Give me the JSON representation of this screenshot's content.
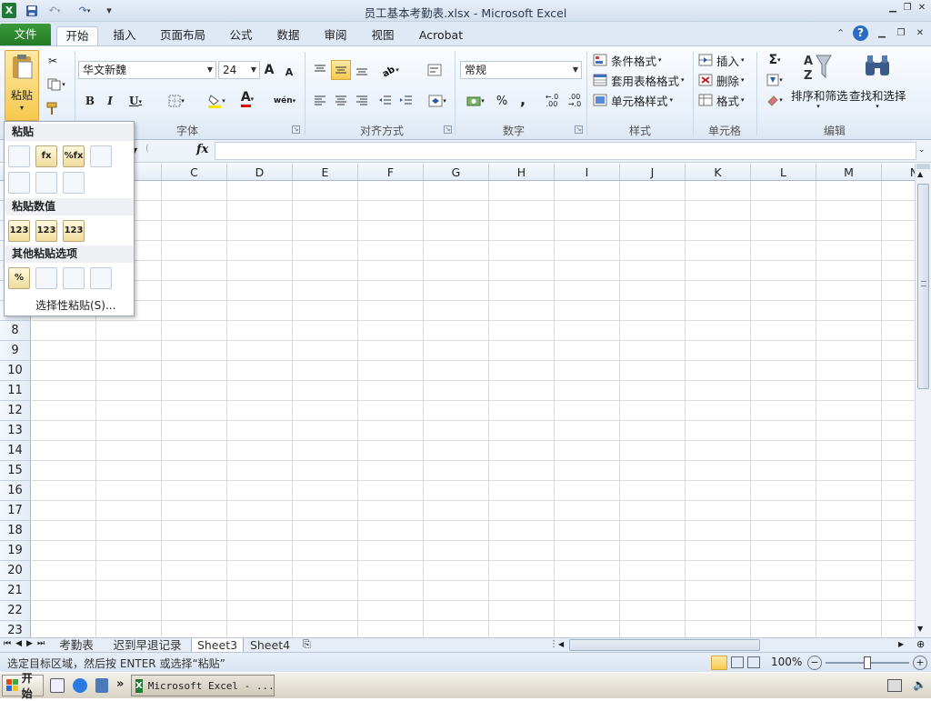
{
  "window": {
    "title": "员工基本考勤表.xlsx  -  Microsoft Excel"
  },
  "qat": {
    "app_icon": "excel-icon",
    "save_icon": "save-icon",
    "undo_icon": "undo-icon",
    "redo_icon": "redo-icon",
    "customize_icon": "customize-qat-icon"
  },
  "tabs": [
    {
      "label": "文件"
    },
    {
      "label": "开始"
    },
    {
      "label": "插入"
    },
    {
      "label": "页面布局"
    },
    {
      "label": "公式"
    },
    {
      "label": "数据"
    },
    {
      "label": "审阅"
    },
    {
      "label": "视图"
    },
    {
      "label": "Acrobat"
    }
  ],
  "ribbon": {
    "clipboard": {
      "paste_label": "粘贴",
      "cut_icon": "cut-icon",
      "copy_icon": "copy-icon",
      "format_painter_icon": "format-painter-icon"
    },
    "font": {
      "group_label": "字体",
      "font_name": "华文新魏",
      "font_size": "24",
      "grow_font": "A",
      "shrink_font": "A",
      "bold": "B",
      "italic": "I",
      "underline": "U",
      "font_color_glyph": "A",
      "phonetic_glyph": "wén"
    },
    "alignment": {
      "group_label": "对齐方式"
    },
    "number": {
      "group_label": "数字",
      "format": "常规",
      "percent": "%",
      "comma": ",",
      "inc_decimal": "←.0 .00",
      "dec_decimal": ".00 →.0"
    },
    "styles": {
      "group_label": "样式",
      "conditional_format": "条件格式",
      "table_format": "套用表格格式",
      "cell_styles": "单元格样式"
    },
    "cells": {
      "group_label": "单元格",
      "insert": "插入",
      "delete": "删除",
      "format": "格式"
    },
    "editing": {
      "group_label": "编辑",
      "autosum_glyph": "Σ",
      "sort_filter": "排序和筛选",
      "find_select": "查找和选择"
    }
  },
  "formula_bar": {
    "fx": "fx",
    "value": ""
  },
  "grid": {
    "columns": [
      "C",
      "D",
      "E",
      "F",
      "G",
      "H",
      "I",
      "J",
      "K",
      "L",
      "M",
      "N"
    ],
    "rows": [
      "8",
      "9",
      "10",
      "11",
      "12",
      "13",
      "14",
      "15",
      "16",
      "17",
      "18",
      "19",
      "20",
      "21",
      "22",
      "23"
    ]
  },
  "paste_menu": {
    "header_paste": "粘贴",
    "header_values": "粘贴数值",
    "header_other": "其他粘贴选项",
    "paste_icons": [
      {
        "glyph": "",
        "icon": "paste-icon"
      },
      {
        "glyph": "fx",
        "icon": "paste-formulas-icon"
      },
      {
        "glyph": "%fx",
        "icon": "paste-formulas-number-format-icon"
      },
      {
        "glyph": "",
        "icon": "keep-source-formatting-icon"
      },
      {
        "glyph": "",
        "icon": "no-borders-icon"
      },
      {
        "glyph": "",
        "icon": "keep-column-widths-icon"
      },
      {
        "glyph": "",
        "icon": "transpose-icon"
      }
    ],
    "value_icons": [
      {
        "glyph": "123",
        "icon": "paste-values-icon"
      },
      {
        "glyph": "123",
        "icon": "values-number-format-icon"
      },
      {
        "glyph": "123",
        "icon": "values-source-formatting-icon"
      }
    ],
    "other_icons": [
      {
        "glyph": "%",
        "icon": "paste-formatting-icon"
      },
      {
        "glyph": "",
        "icon": "paste-link-icon"
      },
      {
        "glyph": "",
        "icon": "paste-picture-icon"
      },
      {
        "glyph": "",
        "icon": "linked-picture-icon"
      }
    ],
    "paste_special": "选择性粘贴(S)..."
  },
  "sheets": [
    {
      "label": "考勤表"
    },
    {
      "label": "迟到早退记录"
    },
    {
      "label": "Sheet3"
    },
    {
      "label": "Sheet4"
    }
  ],
  "status": {
    "message": "选定目标区域，然后按 ENTER 或选择“粘贴”",
    "zoom": "100%",
    "zoom_minus": "−",
    "zoom_plus": "+"
  },
  "taskbar": {
    "start_label": "开始",
    "chevron": "»",
    "task_label": "Microsoft Excel - ..."
  }
}
